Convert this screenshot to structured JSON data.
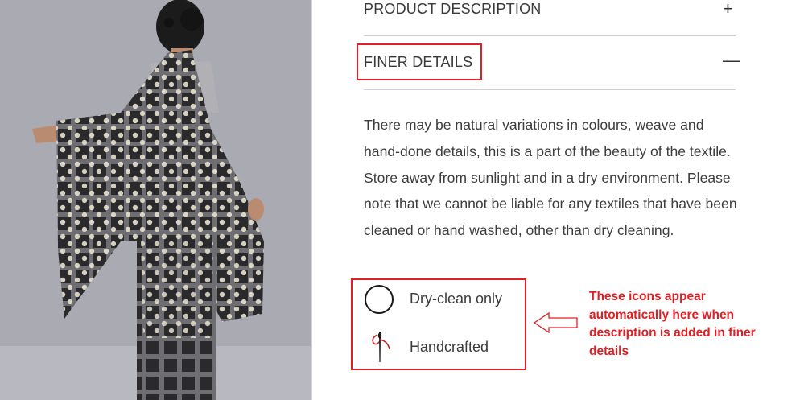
{
  "accordion": {
    "product_description": {
      "title": "PRODUCT DESCRIPTION",
      "toggle": "+"
    },
    "finer_details": {
      "title": "FINER DETAILS",
      "toggle": "—",
      "text": "There may be natural variations in colours, weave and hand-done details, this is a part of the beauty of the textile. Store away from sunlight and in a dry environment. Please note that we cannot be liable for any textiles that have been cleaned or hand washed, other than dry cleaning."
    }
  },
  "care_icons": [
    {
      "icon": "circle-icon",
      "label": "Dry-clean only"
    },
    {
      "icon": "needle-thread-icon",
      "label": "Handcrafted"
    }
  ],
  "annotation": {
    "note": "These icons appear automatically here when description is added in finer details",
    "color": "#e01e25"
  },
  "colors": {
    "accent_red": "#e01e25",
    "text": "#3a3a3a",
    "divider": "#cfcfcf"
  }
}
